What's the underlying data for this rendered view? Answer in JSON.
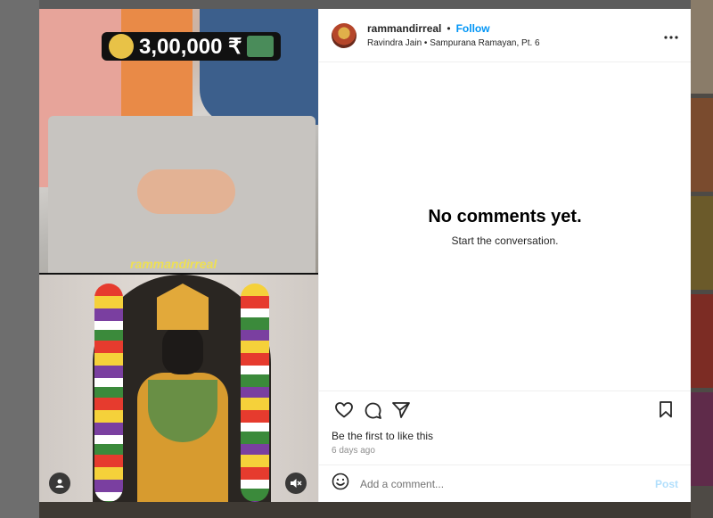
{
  "post": {
    "username": "rammandirreal",
    "follow_label": "Follow",
    "dot": "•",
    "audio_line": "Ravindra Jain • Sampurana Ramayan, Pt. 6",
    "more_icon": "more-horizontal-icon"
  },
  "media": {
    "banner_amount": "3,00,000 ₹",
    "watermark": "rammandirreal",
    "tagged_users_icon": "user-icon",
    "mute_icon": "speaker-muted-icon"
  },
  "comments": {
    "empty_title": "No comments yet.",
    "empty_subtitle": "Start the conversation."
  },
  "actions": {
    "like_icon": "heart-icon",
    "comment_icon": "comment-icon",
    "share_icon": "send-icon",
    "save_icon": "bookmark-icon"
  },
  "likes_text": "Be the first to like this",
  "timestamp": "6 days ago",
  "composer": {
    "emoji_icon": "emoji-icon",
    "placeholder": "Add a comment...",
    "post_label": "Post"
  },
  "colors": {
    "accent": "#0095f6",
    "post_disabled": "#b2dffc",
    "banner_text": "#ffffff",
    "watermark": "#f2e34a"
  }
}
